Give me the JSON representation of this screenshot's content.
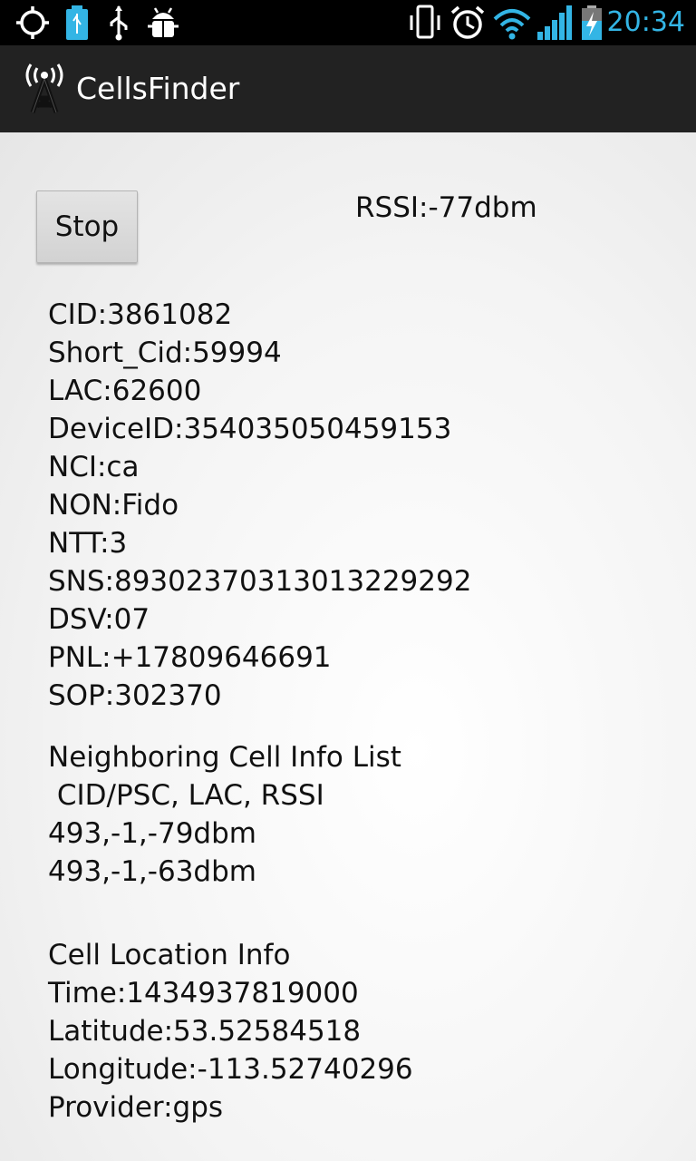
{
  "status_bar": {
    "time": "20:34",
    "left_icons": [
      "gps-icon",
      "usb-storage-icon",
      "usb-icon",
      "android-debug-icon"
    ],
    "right_icons": [
      "vibrate-icon",
      "alarm-icon",
      "wifi-icon",
      "signal-icon",
      "battery-charging-icon"
    ],
    "accent_color": "#33b5e5"
  },
  "action_bar": {
    "title": "CellsFinder",
    "icon": "cell-tower-icon"
  },
  "controls": {
    "stop_label": "Stop",
    "rssi": "RSSI:-77dbm"
  },
  "cell_info": [
    "CID:3861082",
    "Short_Cid:59994",
    "LAC:62600",
    "DeviceID:354035050459153",
    "NCI:ca",
    "NON:Fido",
    "NTT:3",
    "SNS:89302370313013229292",
    "DSV:07",
    "PNL:+17809646691",
    "SOP:302370"
  ],
  "neighbors": {
    "title": "Neighboring Cell Info List",
    "header": " CID/PSC, LAC, RSSI",
    "rows": [
      "493,-1,-79dbm",
      "493,-1,-63dbm"
    ]
  },
  "location": {
    "title": "Cell Location Info",
    "time": "Time:1434937819000",
    "latitude": "Latitude:53.52584518",
    "longitude": "Longitude:-113.52740296",
    "provider": "Provider:gps"
  }
}
